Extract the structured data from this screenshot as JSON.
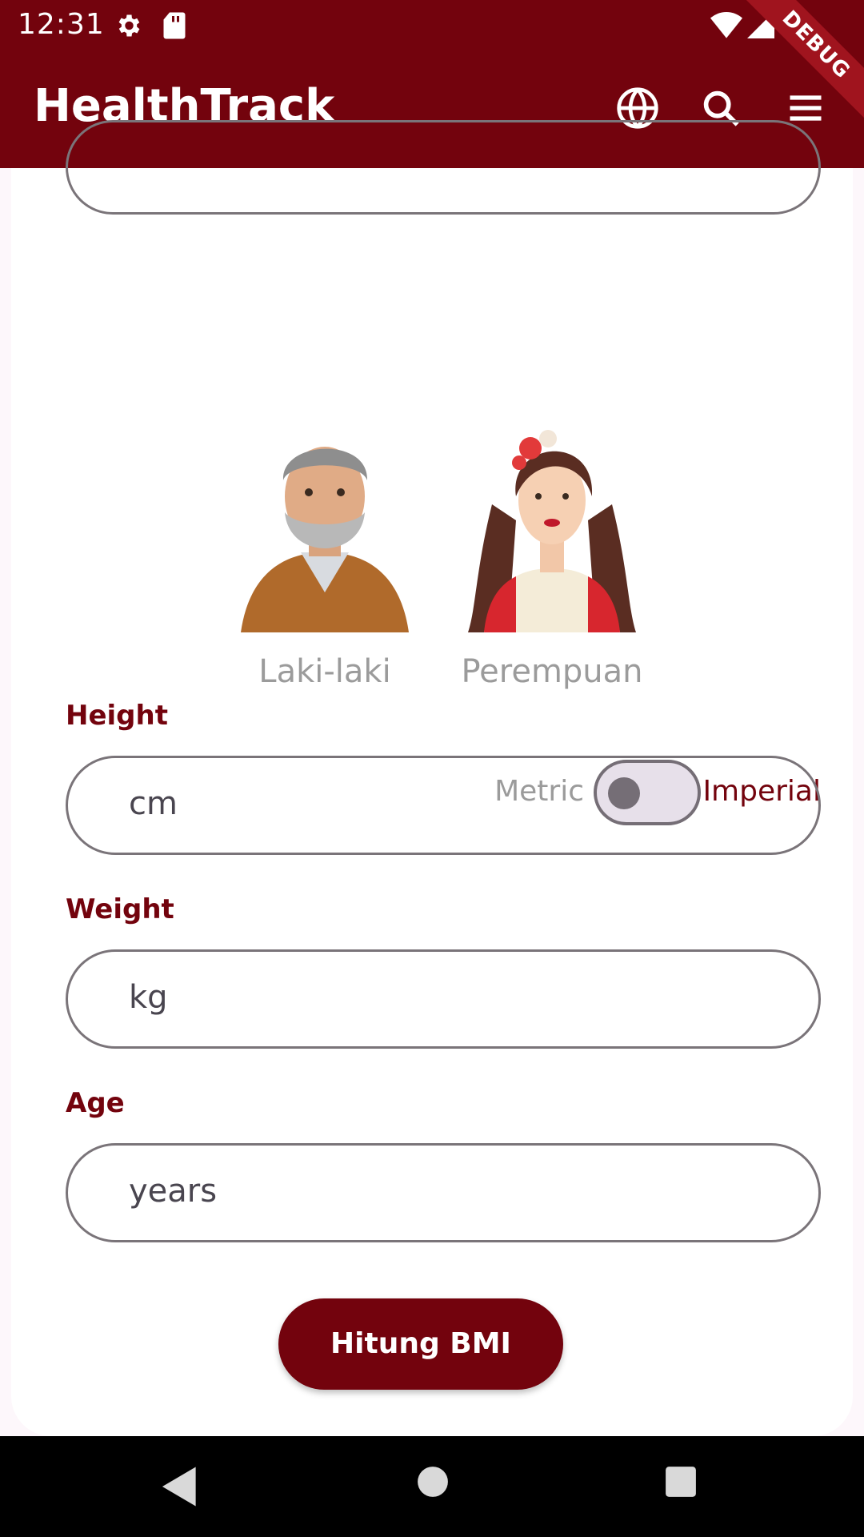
{
  "status_bar": {
    "time": "12:31",
    "debug": "DEBUG"
  },
  "app_bar": {
    "title": "HealthTrack"
  },
  "gender": {
    "male_label": "Laki-laki",
    "female_label": "Perempuan"
  },
  "units": {
    "metric_label": "Metric",
    "imperial_label": "Imperial",
    "imperial_selected": false
  },
  "form": {
    "height_label": "Height",
    "height_placeholder": "cm",
    "weight_label": "Weight",
    "weight_placeholder": "kg",
    "age_label": "Age",
    "age_placeholder": "years"
  },
  "actions": {
    "calculate_label": "Hitung BMI"
  },
  "colors": {
    "primary": "#73030d",
    "outline": "#7a7479",
    "muted_text": "#9b9b9b"
  }
}
